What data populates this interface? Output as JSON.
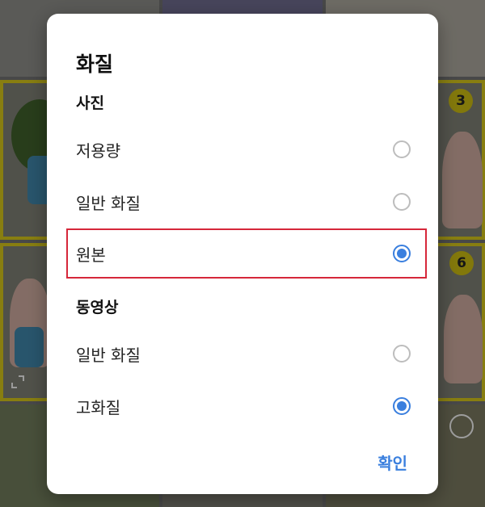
{
  "background": {
    "badges": [
      "3",
      "6"
    ]
  },
  "dialog": {
    "title": "화질",
    "photo_section": "사진",
    "video_section": "동영상",
    "photo_options": [
      {
        "label": "저용량",
        "selected": false
      },
      {
        "label": "일반 화질",
        "selected": false
      },
      {
        "label": "원본",
        "selected": true
      }
    ],
    "video_options": [
      {
        "label": "일반 화질",
        "selected": false
      },
      {
        "label": "고화질",
        "selected": true
      }
    ],
    "confirm_label": "확인",
    "accent_color": "#3a7fde",
    "highlight_color": "#d6273a"
  }
}
